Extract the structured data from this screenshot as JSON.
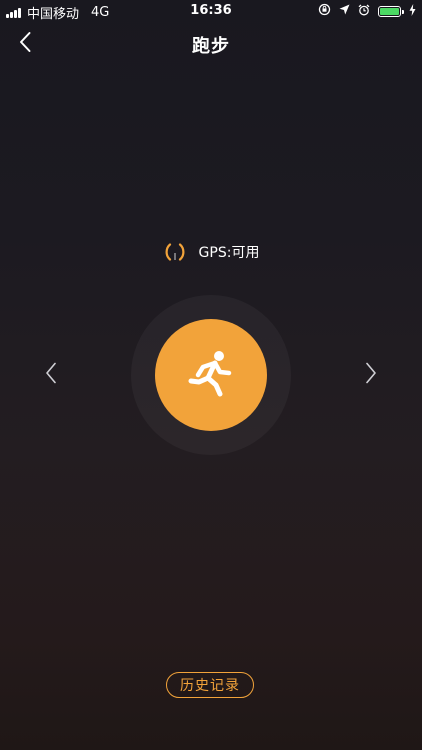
{
  "status_bar": {
    "carrier": "中国移动",
    "network": "4G",
    "time": "16:36",
    "battery_fraction": 1.0,
    "battery_color": "#4cd964",
    "icons": [
      "signal-icon",
      "orientation-lock-icon",
      "location-arrow-icon",
      "alarm-icon",
      "battery-icon",
      "charging-icon"
    ]
  },
  "nav": {
    "back_icon": "chevron-left-icon",
    "title": "跑步"
  },
  "gps": {
    "icon": "gps-signal-icon",
    "label": "GPS:可用"
  },
  "mode": {
    "icon": "running-person-icon",
    "prev_icon": "chevron-left-icon",
    "next_icon": "chevron-right-icon"
  },
  "history": {
    "label": "历史记录"
  },
  "colors": {
    "accent": "#f2a33a",
    "background_top": "#19181f",
    "background_bottom": "#1f1716",
    "text": "#ffffff"
  }
}
